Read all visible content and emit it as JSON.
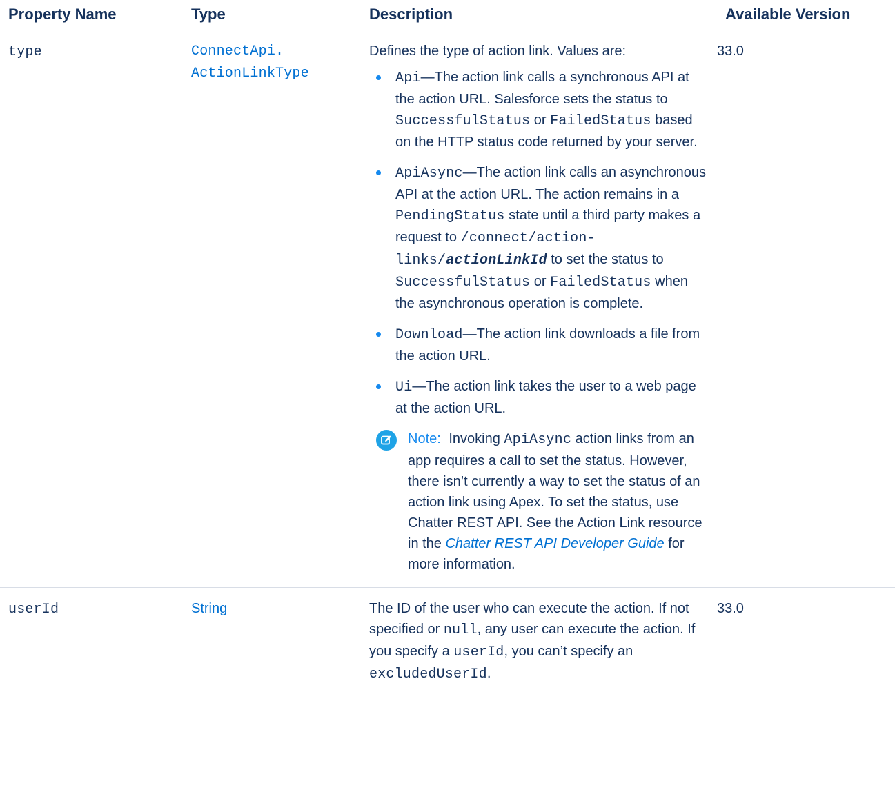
{
  "headers": {
    "property": "Property Name",
    "type": "Type",
    "description": "Description",
    "version": "Available Version"
  },
  "rows": [
    {
      "property": "type",
      "type_line1": "ConnectApi.",
      "type_line2": "ActionLinkType",
      "intro": "Defines the type of action link. Values are:",
      "version": "33.0",
      "items": {
        "api": {
          "code": "Api",
          "t1": "—The action link calls a synchronous API at the action URL. Salesforce sets the status to ",
          "code2": "SuccessfulStatus",
          "t2": " or ",
          "code3": "FailedStatus",
          "t3": " based on the HTTP status code returned by your server."
        },
        "apiasync": {
          "code": "ApiAsync",
          "t1": "—The action link calls an asynchronous API at the action URL. The action remains in a ",
          "code2": "PendingStatus",
          "t2": " state until a third party makes a request to ",
          "code3": "/connect/action-links/",
          "code3b": "actionLinkId",
          "t3": " to set the status to ",
          "code4": "SuccessfulStatus",
          "t4": " or ",
          "code5": "FailedStatus",
          "t5": " when the asynchronous operation is complete."
        },
        "download": {
          "code": "Download",
          "t1": "—The action link downloads a file from the action URL."
        },
        "ui": {
          "code": "Ui",
          "t1": "—The action link takes the user to a web page at the action URL."
        }
      },
      "note": {
        "icon": "edit-note-icon",
        "label": "Note:",
        "t1": " Invoking ",
        "code": "ApiAsync",
        "t2": " action links from an app requires a call to set the status. However, there isn’t currently a way to set the status of an action link using Apex. To set the status, use Chatter REST API. See the Action Link resource in the ",
        "link": "Chatter REST API Developer Guide",
        "t3": " for more information."
      }
    },
    {
      "property": "userId",
      "type": "String",
      "version": "33.0",
      "d1": "The ID of the user who can execute the action. If not specified or ",
      "code1": "null",
      "d2": ", any user can execute the action. If you specify a ",
      "code2": "userId",
      "d3": ", you can’t specify an ",
      "code3": "excludedUserId",
      "d4": "."
    }
  ],
  "colors": {
    "text": "#16325c",
    "link": "#0070d2",
    "bullet": "#1589ee",
    "note_icon": "#1fa3e6",
    "rule": "#d8dde6"
  }
}
